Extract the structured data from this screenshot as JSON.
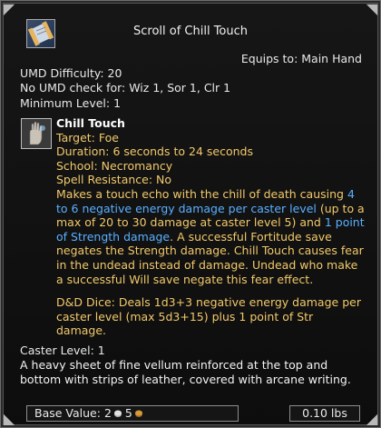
{
  "title": "Scroll of Chill Touch",
  "equips_to": "Equips to: Main Hand",
  "umd_difficulty": "UMD Difficulty: 20",
  "no_umd_check": "No UMD check for: Wiz 1, Sor 1, Clr 1",
  "minimum_level": "Minimum Level: 1",
  "spell": {
    "name": "Chill Touch",
    "target": "Target: Foe",
    "duration": "Duration: 6 seconds to 24 seconds",
    "school": "School: Necromancy",
    "spell_resistance": "Spell Resistance: No",
    "desc_part1": "Makes a touch echo with the chill of death causing ",
    "desc_blue1": "4 to 6 negative energy damage per caster level",
    "desc_part2": " (up to a max of 20 to 30 damage at caster level 5) and ",
    "desc_blue2": "1 point of Strength damage",
    "desc_part3": ". A successful Fortitude save negates the Strength damage. Chill Touch causes fear in the undead instead of damage. Undead who make a successful Will save negate this fear effect.",
    "dd_dice": "D&D Dice: Deals 1d3+3 negative energy damage per caster level (max 5d3+15) plus 1 point of Str damage."
  },
  "caster_level": "Caster Level: 1",
  "flavor": "A heavy sheet of fine vellum reinforced at the top and bottom with strips of leather, covered with arcane writing.",
  "footer": {
    "base_value_label": "Base Value: ",
    "silver": "2",
    "copper": "5",
    "weight": "0.10 lbs"
  },
  "icons": {
    "item": "scroll-icon",
    "spell": "chill-touch-hand-icon",
    "silver": "silver-coin-icon",
    "copper": "copper-coin-icon"
  }
}
